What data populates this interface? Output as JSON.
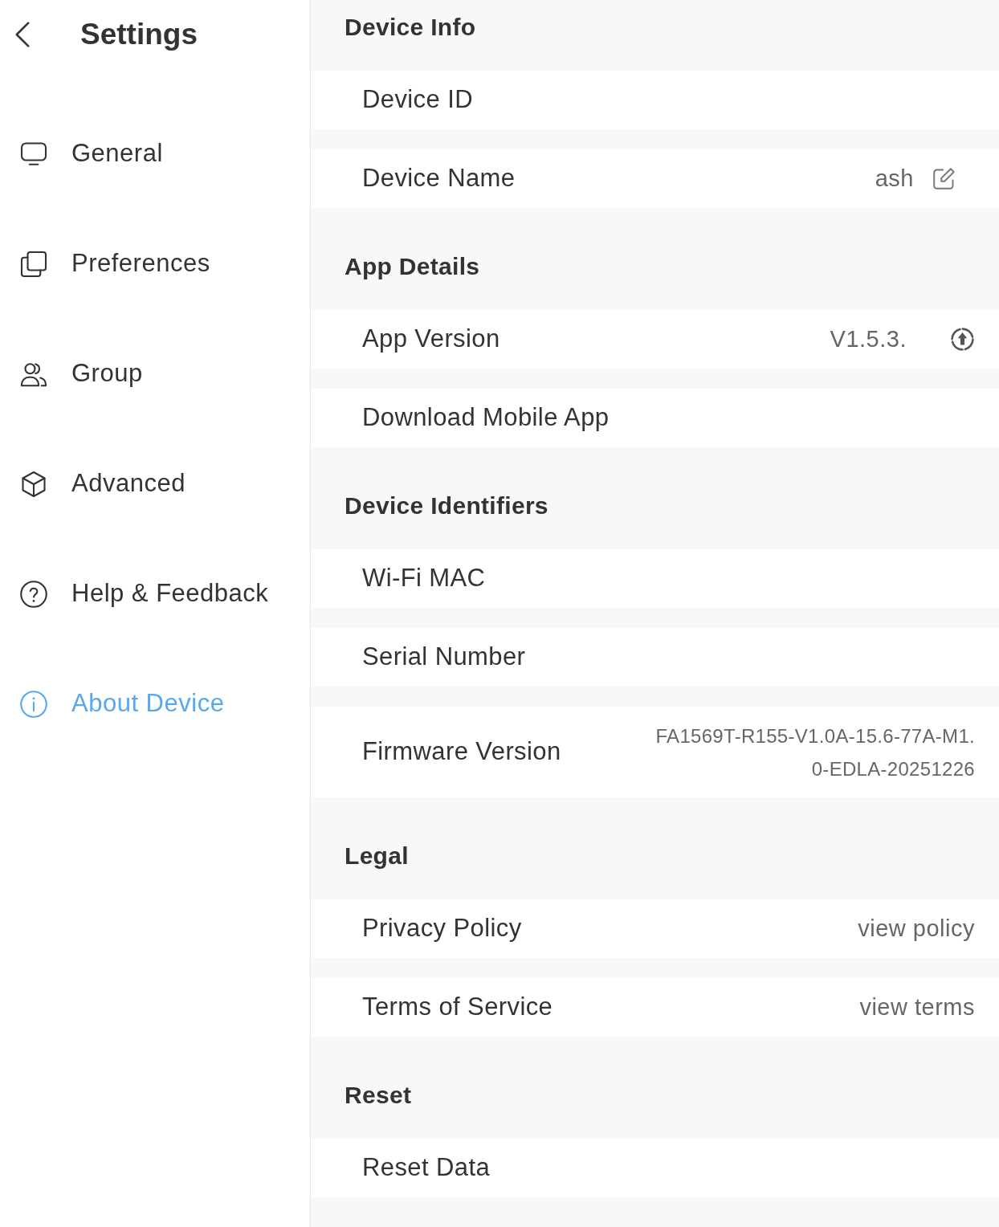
{
  "header": {
    "title": "Settings"
  },
  "sidebar": {
    "items": [
      {
        "label": "General",
        "selected": false
      },
      {
        "label": "Preferences",
        "selected": false
      },
      {
        "label": "Group",
        "selected": false
      },
      {
        "label": "Advanced",
        "selected": false
      },
      {
        "label": "Help & Feedback",
        "selected": false
      },
      {
        "label": "About Device",
        "selected": true
      }
    ]
  },
  "sections": [
    {
      "title": "Device Info",
      "rows": [
        {
          "kind": "plain",
          "label": "Device ID"
        },
        {
          "kind": "edit",
          "label": "Device Name",
          "value": "ash"
        }
      ]
    },
    {
      "title": "App Details",
      "rows": [
        {
          "kind": "update",
          "label": "App Version",
          "value": "V1.5.3."
        },
        {
          "kind": "plain",
          "label": "Download Mobile App"
        }
      ]
    },
    {
      "title": "Device Identifiers",
      "rows": [
        {
          "kind": "plain",
          "label": "Wi-Fi MAC"
        },
        {
          "kind": "plain",
          "label": "Serial Number"
        },
        {
          "kind": "multiline",
          "label": "Firmware Version",
          "value_lines": [
            "FA1569T-R155-V1.0A-15.6-77A-M1.",
            "0-EDLA-20251226"
          ]
        }
      ]
    },
    {
      "title": "Legal",
      "rows": [
        {
          "kind": "link",
          "label": "Privacy Policy",
          "value": "view policy"
        },
        {
          "kind": "link",
          "label": "Terms of Service",
          "value": "view terms"
        }
      ]
    },
    {
      "title": "Reset",
      "rows": [
        {
          "kind": "plain",
          "label": "Reset Data"
        }
      ]
    }
  ]
}
